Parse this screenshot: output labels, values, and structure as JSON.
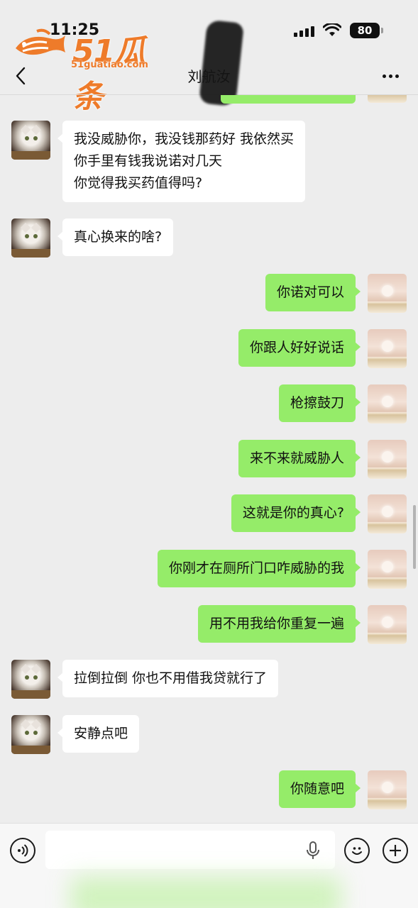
{
  "status_bar": {
    "time": "11:25",
    "battery": "80"
  },
  "watermark": {
    "brand": "51瓜条",
    "url": "51guatiao.com"
  },
  "header": {
    "title": "刘航汝"
  },
  "messages": [
    {
      "side": "in",
      "text": "我没威胁你，我没钱那药好 我依然买\n你手里有钱我说诺对几天\n你觉得我买药值得吗?"
    },
    {
      "side": "in",
      "text": "真心换来的啥?"
    },
    {
      "side": "out",
      "text": "你诺对可以"
    },
    {
      "side": "out",
      "text": "你跟人好好说话"
    },
    {
      "side": "out",
      "text": "枪擦鼓刀"
    },
    {
      "side": "out",
      "text": "来不来就威胁人"
    },
    {
      "side": "out",
      "text": "这就是你的真心?"
    },
    {
      "side": "out",
      "text": "你刚才在厕所门口咋威胁的我"
    },
    {
      "side": "out",
      "text": "用不用我给你重复一遍"
    },
    {
      "side": "in",
      "text": "拉倒拉倒 你也不用借我贷就行了"
    },
    {
      "side": "in",
      "text": "安静点吧"
    },
    {
      "side": "out",
      "text": "你随意吧"
    }
  ],
  "input": {
    "value": "",
    "placeholder": ""
  },
  "icons": {
    "back": "back-arrow-icon",
    "more": "more-dots-icon",
    "voice": "voice-icon",
    "mic": "mic-icon",
    "emoji": "emoji-icon",
    "plus": "plus-icon"
  },
  "colors": {
    "outgoing_bubble": "#95ec69",
    "incoming_bubble": "#ffffff",
    "background": "#ededed"
  }
}
